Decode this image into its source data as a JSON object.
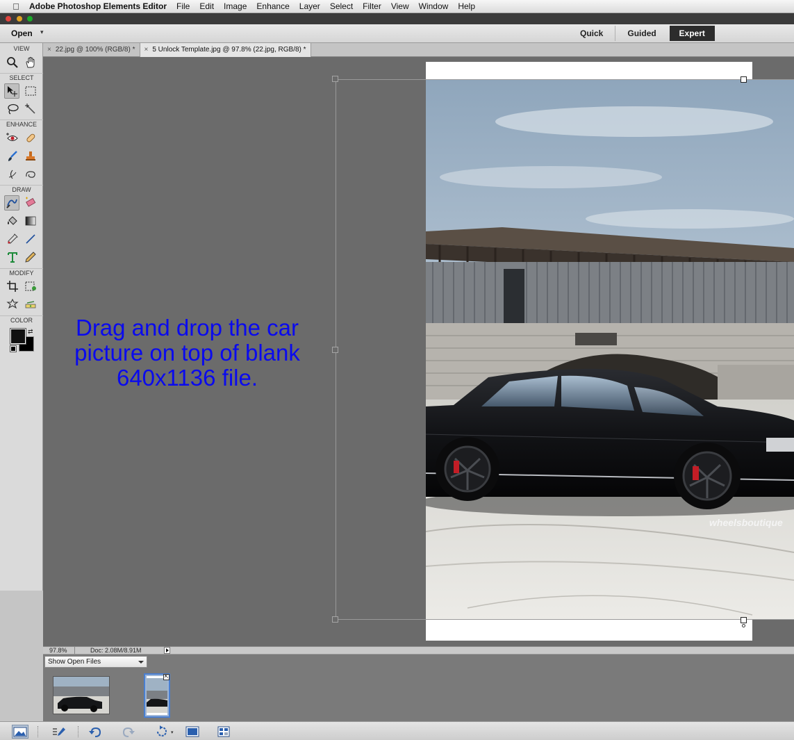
{
  "menubar": {
    "app_name": "Adobe Photoshop Elements Editor",
    "items": [
      "File",
      "Edit",
      "Image",
      "Enhance",
      "Layer",
      "Select",
      "Filter",
      "View",
      "Window",
      "Help"
    ]
  },
  "topbar": {
    "open_label": "Open",
    "modes": {
      "quick": "Quick",
      "guided": "Guided",
      "expert": "Expert"
    },
    "active_mode": "Expert"
  },
  "toolbox": {
    "sections": {
      "view": "VIEW",
      "select": "SELECT",
      "enhance": "ENHANCE",
      "draw": "DRAW",
      "modify": "MODIFY",
      "color": "COLOR"
    },
    "tools": [
      "zoom-icon",
      "hand-icon",
      "move-icon",
      "marquee-icon",
      "lasso-icon",
      "magic-wand-icon",
      "red-eye-icon",
      "spot-healing-icon",
      "smart-brush-icon",
      "clone-stamp-icon",
      "blur-icon",
      "sponge-icon",
      "brush-icon",
      "eraser-icon",
      "paint-bucket-icon",
      "gradient-icon",
      "eyedropper-icon",
      "line-icon",
      "type-icon",
      "pencil-icon",
      "crop-icon",
      "recompose-icon",
      "cookie-cutter-icon",
      "straighten-icon"
    ],
    "foreground_color": "#111111",
    "background_color": "#000000"
  },
  "tabs": [
    {
      "label": "22.jpg @ 100% (RGB/8) *",
      "active": false
    },
    {
      "label": "5 Unlock Template.jpg @ 97.8% (22.jpg, RGB/8) *",
      "active": true
    }
  ],
  "canvas": {
    "instruction": "Drag and drop the car picture on top of blank 640x1136 file.",
    "watermark": "wheelsboutique",
    "instruction_color": "#0a0aee"
  },
  "status": {
    "zoom": "97.8%",
    "doc": "Doc: 2.08M/8.91M"
  },
  "photo_bin": {
    "select_label": "Show Open Files"
  }
}
